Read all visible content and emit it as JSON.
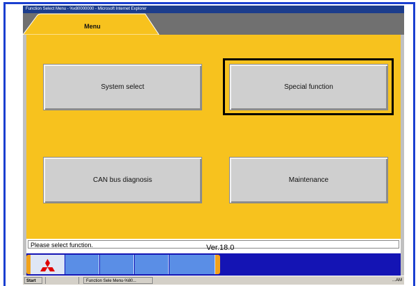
{
  "window": {
    "title": "Function Select Menu - %x80000000 - Microsoft Internet Explorer"
  },
  "tab": {
    "label": "Menu"
  },
  "functions": {
    "system_select": "System select",
    "special_function": "Special function",
    "can_bus_diagnosis": "CAN bus diagnosis",
    "maintenance": "Maintenance"
  },
  "status": {
    "message": "Please select function.",
    "version": "Ver.18.0"
  },
  "navbar": {
    "logo_icon": "mitsubishi-logo-icon"
  },
  "taskbar": {
    "start_label": "Start",
    "task_label": "Function Sele Menu-%80...",
    "tray_text": "...AM"
  },
  "colors": {
    "content_bg": "#f7c21e",
    "nav_bg": "#1414b4",
    "nav_accent": "#f2a21a",
    "title_bg": "#1c3d8c",
    "logo_red": "#e00000"
  }
}
